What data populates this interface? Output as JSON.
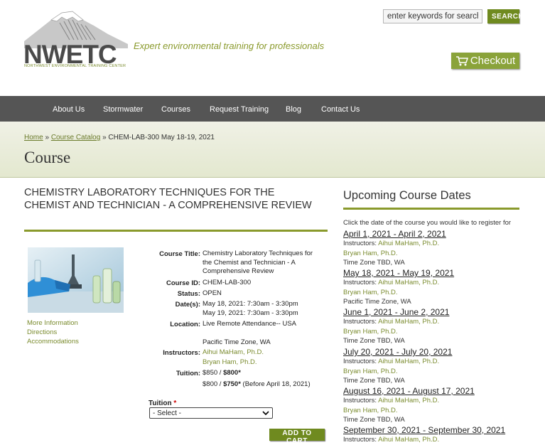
{
  "header": {
    "logo_text": "NWETC",
    "logo_subtitle": "NORTHWEST ENVIRONMENTAL TRAINING CENTER",
    "tagline": "Expert environmental training for professionals",
    "search_placeholder": "enter keywords for search...",
    "search_button": "SEARCH",
    "checkout_label": "Checkout"
  },
  "nav": [
    "About Us",
    "Stormwater",
    "Courses",
    "Request Training",
    "Blog",
    "Contact Us"
  ],
  "breadcrumb": {
    "home": "Home",
    "sep1": "»",
    "catalog": "Course Catalog",
    "sep2": "»",
    "current": "CHEM-LAB-300 May 18-19, 2021"
  },
  "page_title": "Course",
  "course": {
    "heading": "CHEMISTRY LABORATORY TECHNIQUES FOR THE CHEMIST AND TECHNICIAN - A COMPREHENSIVE REVIEW",
    "side_links": [
      "More Information",
      "Directions",
      "Accommodations"
    ],
    "labels": {
      "title": "Course Title:",
      "id": "Course ID:",
      "status": "Status:",
      "dates": "Date(s):",
      "location": "Location:",
      "instructors": "Instructors:",
      "tuition": "Tuition:"
    },
    "title": "Chemistry Laboratory Techniques for the Chemist and Technician - A Comprehensive Review",
    "id": "CHEM-LAB-300",
    "status": "OPEN",
    "dates": [
      "May 18, 2021: 7:30am - 3:30pm",
      "May 19, 2021: 7:30am - 3:30pm"
    ],
    "location": "Live Remote Attendance-- USA",
    "timezone": "Pacific Time Zone, WA",
    "instructors": [
      "Aihui MaHam, Ph.D.",
      "Bryan Ham, Ph.D."
    ],
    "tuition_line1_a": "$850 / ",
    "tuition_line1_b": "$800*",
    "tuition_line2_a": "$800 / ",
    "tuition_line2_b": "$750*",
    "tuition_line2_c": " (Before April 18, 2021)",
    "tuition_field_label": "Tuition",
    "required_mark": "*",
    "tuition_select_value": "- Select -",
    "add_to_cart": "ADD TO CART"
  },
  "upcoming": {
    "title": "Upcoming Course Dates",
    "instruction": "Click the date of the course you would like to register for",
    "instructors_label": "Instructors:",
    "sessions": [
      {
        "date": "April 1, 2021 - April 2, 2021",
        "instructors": [
          "Aihui MaHam, Ph.D.",
          "Bryan Ham, Ph.D."
        ],
        "timezone": "Time Zone TBD, WA"
      },
      {
        "date": "May 18, 2021 - May 19, 2021",
        "instructors": [
          "Aihui MaHam, Ph.D.",
          "Bryan Ham, Ph.D."
        ],
        "timezone": "Pacific Time Zone, WA"
      },
      {
        "date": "June 1, 2021 - June 2, 2021",
        "instructors": [
          "Aihui MaHam, Ph.D.",
          "Bryan Ham, Ph.D."
        ],
        "timezone": "Time Zone TBD, WA"
      },
      {
        "date": "July 20, 2021 - July 20, 2021",
        "instructors": [
          "Aihui MaHam, Ph.D.",
          "Bryan Ham, Ph.D."
        ],
        "timezone": "Time Zone TBD, WA"
      },
      {
        "date": "August 16, 2021 - August 17, 2021",
        "instructors": [
          "Aihui MaHam, Ph.D.",
          "Bryan Ham, Ph.D."
        ],
        "timezone": "Time Zone TBD, WA"
      },
      {
        "date": "September 30, 2021 - September 30, 2021",
        "instructors": [
          "Aihui MaHam, Ph.D."
        ],
        "timezone": ""
      }
    ]
  },
  "colors": {
    "accent_green": "#8a9a2c",
    "button_green": "#6f8a1f",
    "nav_bg": "#555555"
  }
}
